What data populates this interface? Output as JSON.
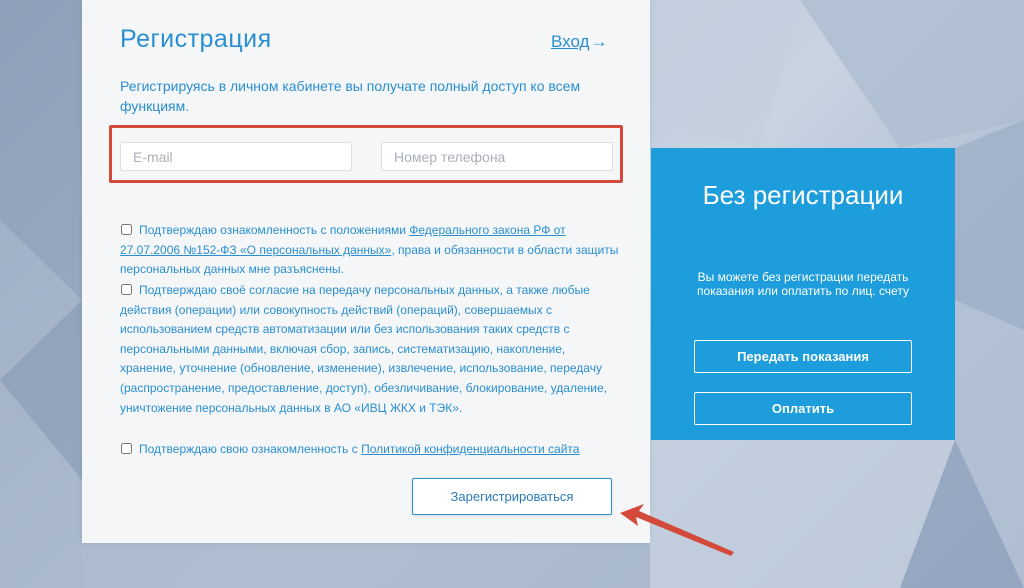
{
  "registration": {
    "title": "Регистрация",
    "login_link": "Вход",
    "login_arrow": "→",
    "intro": "Регистрируясь в личном кабинете вы получате полный доступ ко всем функциям.",
    "email_placeholder": "E-mail",
    "phone_placeholder": "Номер телефона",
    "consent1": {
      "prefix": "Подтверждаю ознакомленность с положениями ",
      "link": "Федерального закона РФ от 27.07.2006 №152-ФЗ «О персональных данных»",
      "suffix": ", права и обязанности в области защиты персональных данных мне разъяснены."
    },
    "consent2": {
      "text": "Подтверждаю своё согласие на передачу персональных данных, а также любые действия (операции) или совокупность действий (операций), совершаемых с использованием средств автоматизации или без использования таких средств с персональными данными, включая сбор, запись, систематизацию, накопление, хранение, уточнение (обновление, изменение), извлечение, использование, передачу (распространение, предоставление, доступ), обезличивание, блокирование, удаление, уничтожение персональных данных в АО «ИВЦ ЖКХ и ТЭК»."
    },
    "consent3": {
      "prefix": "Подтверждаю свою ознакомленность с ",
      "link": "Политикой конфиденциальности сайта"
    },
    "submit_label": "Зарегистрироваться"
  },
  "no_registration": {
    "title": "Без регистрации",
    "text": "Вы можете без регистрации передать показания или оплатить по лиц. счету",
    "submit_readings_label": "Передать показания",
    "pay_label": "Оплатить"
  },
  "colors": {
    "accent": "#2a8fd0",
    "side_panel": "#1d9ddb",
    "highlight": "#d44a3a"
  }
}
